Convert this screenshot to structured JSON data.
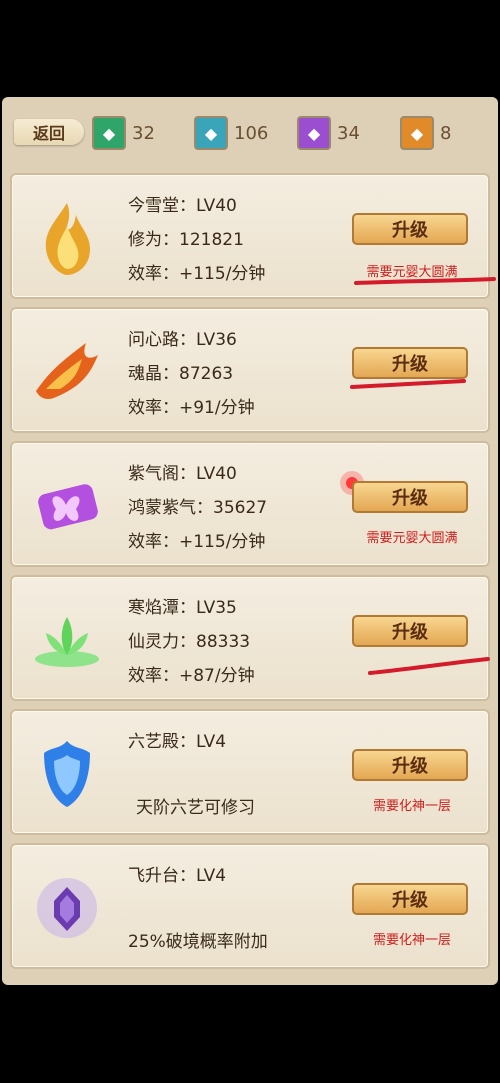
{
  "topbar": {
    "back_label": "返回",
    "resources": [
      {
        "icon": "green-gem-icon",
        "color": "#2fa56a",
        "value": "32"
      },
      {
        "icon": "teal-gem-icon",
        "color": "#3aa4b8",
        "value": "106"
      },
      {
        "icon": "purple-gem-icon",
        "color": "#9b4fd0",
        "value": "34"
      },
      {
        "icon": "orange-gem-icon",
        "color": "#e08a2a",
        "value": "8"
      }
    ]
  },
  "buildings": [
    {
      "name": "今雪堂：LV40",
      "line2": "修为：121821",
      "line3": "效率：+115/分钟",
      "button": "升级",
      "requirement": "需要元婴大圆满"
    },
    {
      "name": "问心路：LV36",
      "line2": "魂晶：87263",
      "line3": "效率：+91/分钟",
      "button": "升级",
      "requirement": ""
    },
    {
      "name": "紫气阁：LV40",
      "line2": "鸿蒙紫气：35627",
      "line3": "效率：+115/分钟",
      "button": "升级",
      "requirement": "需要元婴大圆满"
    },
    {
      "name": "寒焰潭：LV35",
      "line2": "仙灵力：88333",
      "line3": "效率：+87/分钟",
      "button": "升级",
      "requirement": ""
    },
    {
      "name": "六艺殿：LV4",
      "line2": "天阶六艺可修习",
      "line3": "",
      "button": "升级",
      "requirement": "需要化神一层"
    },
    {
      "name": "飞升台：LV4",
      "line2": "25%破境概率附加",
      "line3": "",
      "button": "升级",
      "requirement": "需要化神一层"
    }
  ],
  "colors": {
    "requirement": "#d01e1e",
    "accent": "#e3a753"
  }
}
